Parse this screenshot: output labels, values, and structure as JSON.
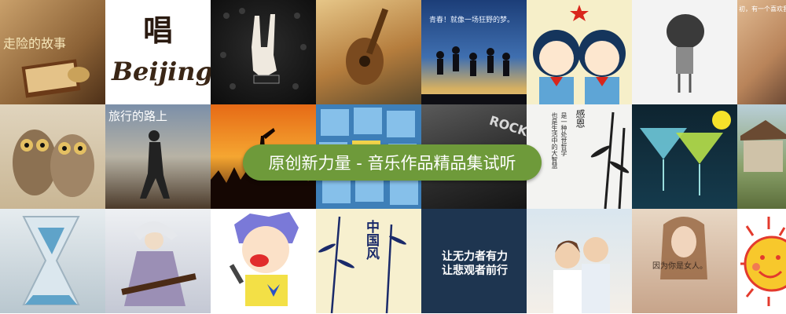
{
  "banner": {
    "title": "原创新力量 - 音乐作品精品集试听"
  },
  "tiles": {
    "r1c1": {
      "text": "走险的故事"
    },
    "r1c2": {
      "text_top": "唱",
      "text_bottom": "Beijing"
    },
    "r1c5": {
      "text": "青春！就像一场狂野的梦。"
    },
    "r1c8": {
      "text": "初，有一个喜欢我的人"
    },
    "r2c2": {
      "text": "旅行的路上"
    },
    "r2c5": {
      "text": "ROCK"
    },
    "r2c6": {
      "text_a": "感恩",
      "text_b": "是一种处世哲学",
      "text_c": "也是生活中的大智慧"
    },
    "r3c4": {
      "text": "中国风"
    },
    "r3c5": {
      "line1": "让无力者有力",
      "line2": "让悲观者前行"
    },
    "r3c7": {
      "text": "因为你是女人。"
    }
  },
  "colors": {
    "pill": "#6e9a3a",
    "poster_navy": "#1e3550"
  }
}
